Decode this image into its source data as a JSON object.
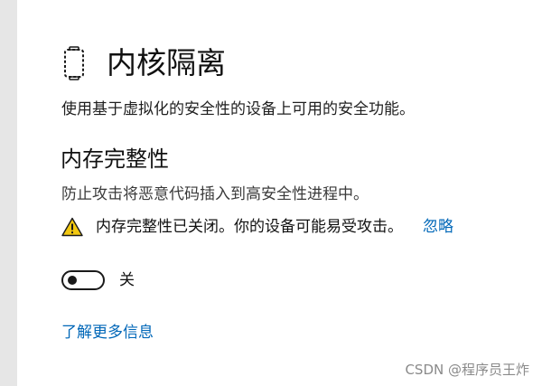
{
  "page": {
    "title": "内核隔离",
    "description": "使用基于虚拟化的安全性的设备上可用的安全功能。",
    "header_icon": "core-isolation-icon"
  },
  "memory_integrity": {
    "title": "内存完整性",
    "description": "防止攻击将恶意代码插入到高安全性进程中。",
    "warning": {
      "icon": "warning-icon",
      "text": "内存完整性已关闭。你的设备可能易受攻击。",
      "dismiss_label": "忽略"
    },
    "toggle": {
      "state": "off",
      "label": "关"
    }
  },
  "learn_more_label": "了解更多信息",
  "watermark": "CSDN @程序员王炸",
  "colors": {
    "link": "#0067b8",
    "warning_fill": "#f2c811",
    "sidebar_strip": "#e6e6e6"
  }
}
